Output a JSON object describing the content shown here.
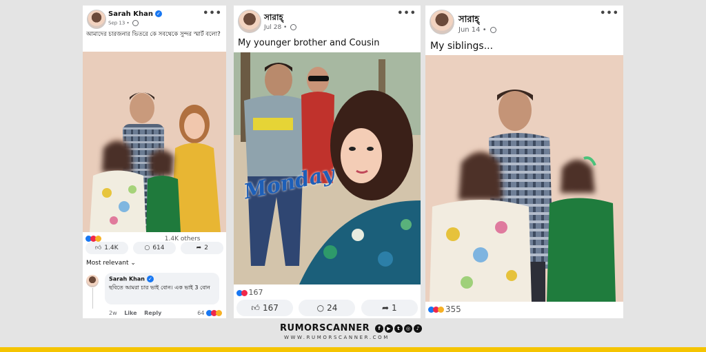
{
  "post1": {
    "name": "Sarah Khan",
    "date": "Sep 13",
    "caption": "আমাদের চারজনার ভিতরে কে সবথেকে সুন্দর স্মার্ট বলো?",
    "reactions_text": "1.4K others",
    "likes": "1.4K",
    "comments": "614",
    "shares": "2",
    "most_relevant": "Most relevant",
    "comment": {
      "name": "Sarah Khan",
      "text": "ছবিতে আমরা চার ভাই বোন। এক ভাই 3 বোন",
      "time": "2w",
      "like": "Like",
      "reply": "Reply",
      "count": "64"
    }
  },
  "post2": {
    "name": "সারাহ্",
    "date": "Jul 28",
    "caption": "My younger brother and Cousin",
    "photo_text": "Monday",
    "reactions_count": "167",
    "likes": "167",
    "comments": "24",
    "shares": "1"
  },
  "post3": {
    "name": "সারাহ্",
    "date": "Jun 14",
    "caption": "My siblings...",
    "reactions_count": "355"
  },
  "footer": {
    "brand": "RUMORSCANNER",
    "url": "WWW.RUMORSCANNER.COM",
    "social_icons": [
      "facebook-icon",
      "youtube-icon",
      "twitter-icon",
      "instagram-icon",
      "tiktok-icon"
    ]
  },
  "colors": {
    "background": "#e4e4e4",
    "accent_bar": "#f5c400",
    "verified": "#1877f2"
  }
}
